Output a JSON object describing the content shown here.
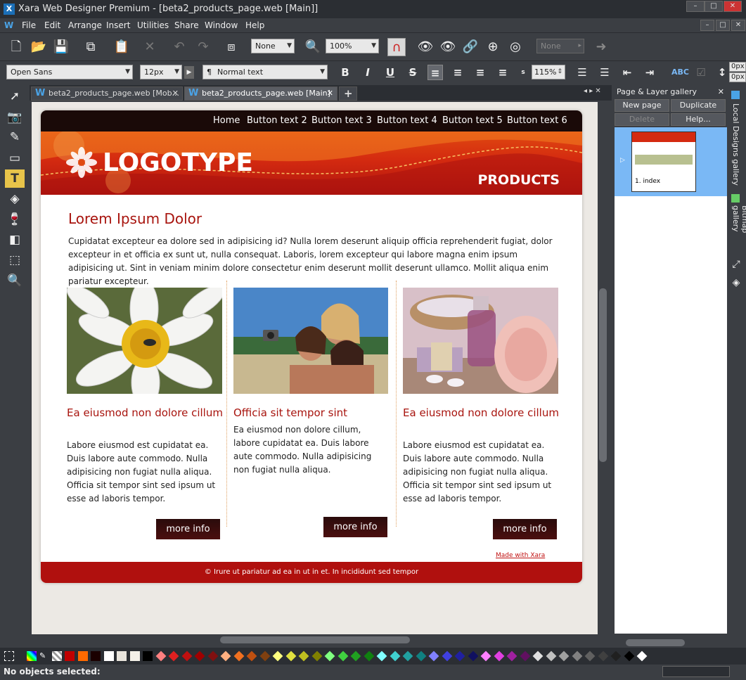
{
  "window": {
    "title": "Xara Web Designer Premium - [beta2_products_page.web [Main]]",
    "controls": [
      "minimize",
      "maximize",
      "close"
    ]
  },
  "menu": [
    "File",
    "Edit",
    "Arrange",
    "Insert",
    "Utilities",
    "Share",
    "Window",
    "Help"
  ],
  "toolbar": {
    "fill_value": "None",
    "zoom_value": "100%",
    "name_value": "None"
  },
  "text_toolbar": {
    "font": "Open Sans",
    "size": "12px",
    "style": "Normal text",
    "line_spacing": "115%",
    "spacing_a": "0px",
    "spacing_b": "0px"
  },
  "tabs": [
    {
      "label": "beta2_products_page.web [Mob..."
    },
    {
      "label": "beta2_products_page.web [Main]"
    }
  ],
  "page": {
    "nav": [
      "Home",
      "Button text 2",
      "Button text 3",
      "Button text 4",
      "Button text 5",
      "Button text 6"
    ],
    "logo": "LOGOTYPE",
    "banner_title": "PRODUCTS",
    "heading": "Lorem Ipsum Dolor",
    "intro": "Cupidatat excepteur ea dolore sed in adipisicing id? Nulla lorem deserunt aliquip officia reprehenderit fugiat, dolor excepteur in et officia ex sunt ut, nulla consequat. Laboris, lorem excepteur qui labore magna enim ipsum adipisicing ut. Sint in veniam minim dolore consectetur enim deserunt mollit deserunt ullamco. Mollit aliqua enim pariatur excepteur.",
    "columns": [
      {
        "title": "Ea eiusmod non dolore cillum",
        "text": " Labore eiusmod est cupidatat ea. Duis labore aute commodo. Nulla adipisicing non fugiat nulla aliqua. Officia sit tempor sint sed ipsum ut esse ad laboris tempor.",
        "button": "more info",
        "image": "daisy-flower"
      },
      {
        "title": "Officia sit tempor sint",
        "text": "Ea eiusmod non dolore cillum, labore cupidatat ea. Duis labore aute commodo. Nulla adipisicing non fugiat nulla aliqua.",
        "button": "more info",
        "image": "girls-selfie"
      },
      {
        "title": "Ea eiusmod non dolore cillum",
        "text": "Labore eiusmod est cupidatat ea. Duis labore aute commodo. Nulla adipisicing non fugiat nulla aliqua. Officia sit tempor sint sed ipsum ut esse ad laboris tempor.",
        "button": "more info",
        "image": "spa-towel"
      }
    ],
    "made_with": "Made with Xara",
    "footer": "© Irure ut pariatur ad ea in ut in et. In incididunt sed tempor"
  },
  "gallery": {
    "title": "Page & Layer gallery",
    "buttons": {
      "new_page": "New page",
      "duplicate": "Duplicate",
      "delete": "Delete",
      "help": "Help..."
    },
    "page_label": "1. index",
    "side_tabs": [
      "Local Designs gallery",
      "Bitmap gallery"
    ]
  },
  "status": {
    "text": "No objects selected:"
  },
  "colors": {
    "accent_red": "#a8140e",
    "banner_orange": "#e04a10",
    "selection_blue": "#7ab8f5"
  }
}
